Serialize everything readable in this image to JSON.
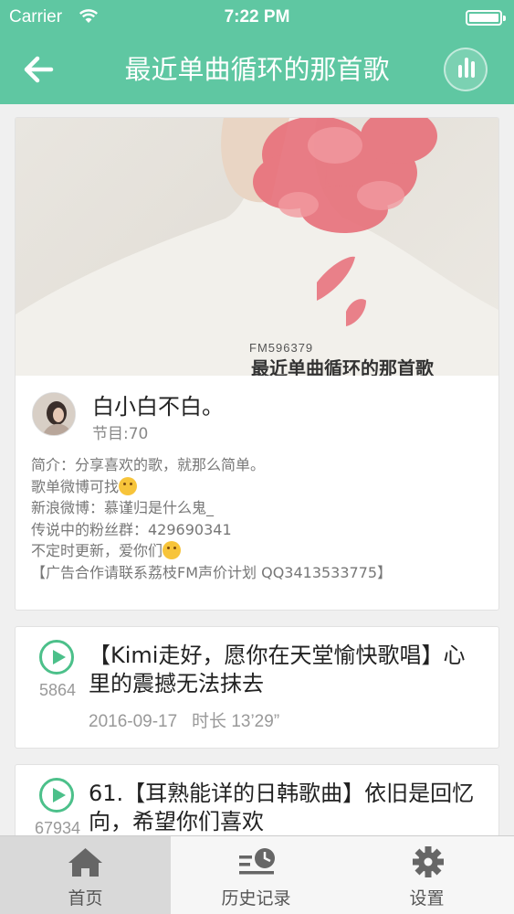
{
  "status_bar": {
    "carrier": "Carrier",
    "time": "7:22 PM"
  },
  "nav": {
    "title": "最近单曲循环的那首歌",
    "back_icon": "arrow-left-icon",
    "player_icon": "equalizer-icon"
  },
  "album": {
    "cover_fm": "FM596379",
    "cover_title": "最近单曲循环的那首歌",
    "author": "白小白不白。",
    "episodes": "节目:70",
    "intro": [
      "简介：分享喜欢的歌，就那么简单。",
      "歌单微博可找",
      "新浪微博：慕谨归是什么鬼_",
      "传说中的粉丝群：429690341",
      "不定时更新，爱你们",
      "【广告合作请联系荔枝FM声价计划 QQ3413533775】"
    ]
  },
  "tracks": [
    {
      "plays": "5864",
      "title": "【Kimi走好，愿你在天堂愉快歌唱】心里的震撼无法抹去",
      "date": "2016-09-17",
      "duration": "时长 13’29”"
    },
    {
      "plays": "67934",
      "title": "61.【耳熟能详的日韩歌曲】依旧是回忆向，希望你们喜欢"
    }
  ],
  "tabs": [
    {
      "label": "首页",
      "icon": "home-icon",
      "active": true
    },
    {
      "label": "历史记录",
      "icon": "history-icon",
      "active": false
    },
    {
      "label": "设置",
      "icon": "gear-icon",
      "active": false
    }
  ],
  "colors": {
    "brand": "#5fc7a2",
    "play": "#4cc08a"
  }
}
